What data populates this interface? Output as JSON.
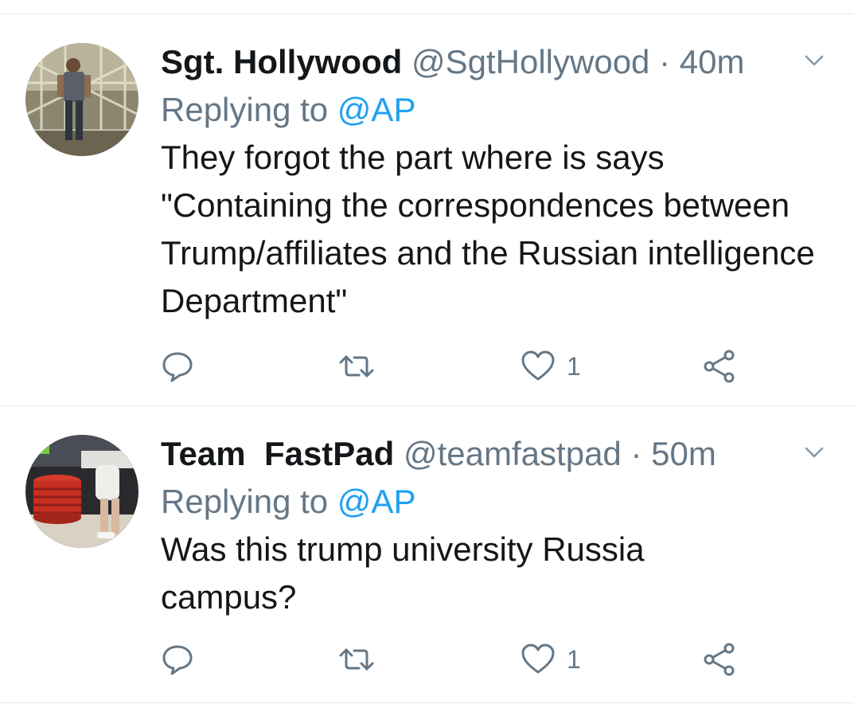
{
  "tweets": [
    {
      "name": "Sgt. Hollywood",
      "handle": "@SgtHollywood",
      "separator": "·",
      "time": "40m",
      "replying_prefix": "Replying to",
      "replying_to": "@AP",
      "text": "They forgot the part where is says \"Containing the correspondences between Trump/affiliates and the Russian intelligence Department\"",
      "reply_count": "",
      "retweet_count": "",
      "like_count": "1"
    },
    {
      "name": "Team  FastPad",
      "handle": "@teamfastpad",
      "separator": "·",
      "time": "50m",
      "replying_prefix": "Replying to",
      "replying_to": "@AP",
      "text": "Was this trump university Russia campus?",
      "reply_count": "",
      "retweet_count": "",
      "like_count": "1"
    }
  ],
  "icons": {
    "reply": "speech-bubble-icon",
    "retweet": "retweet-arrows-icon",
    "like": "heart-icon",
    "share": "share-nodes-icon",
    "more": "chevron-down-icon"
  },
  "colors": {
    "text": "#14171a",
    "secondary": "#657786",
    "link": "#1da1f2",
    "divider": "#e1e8ed"
  }
}
